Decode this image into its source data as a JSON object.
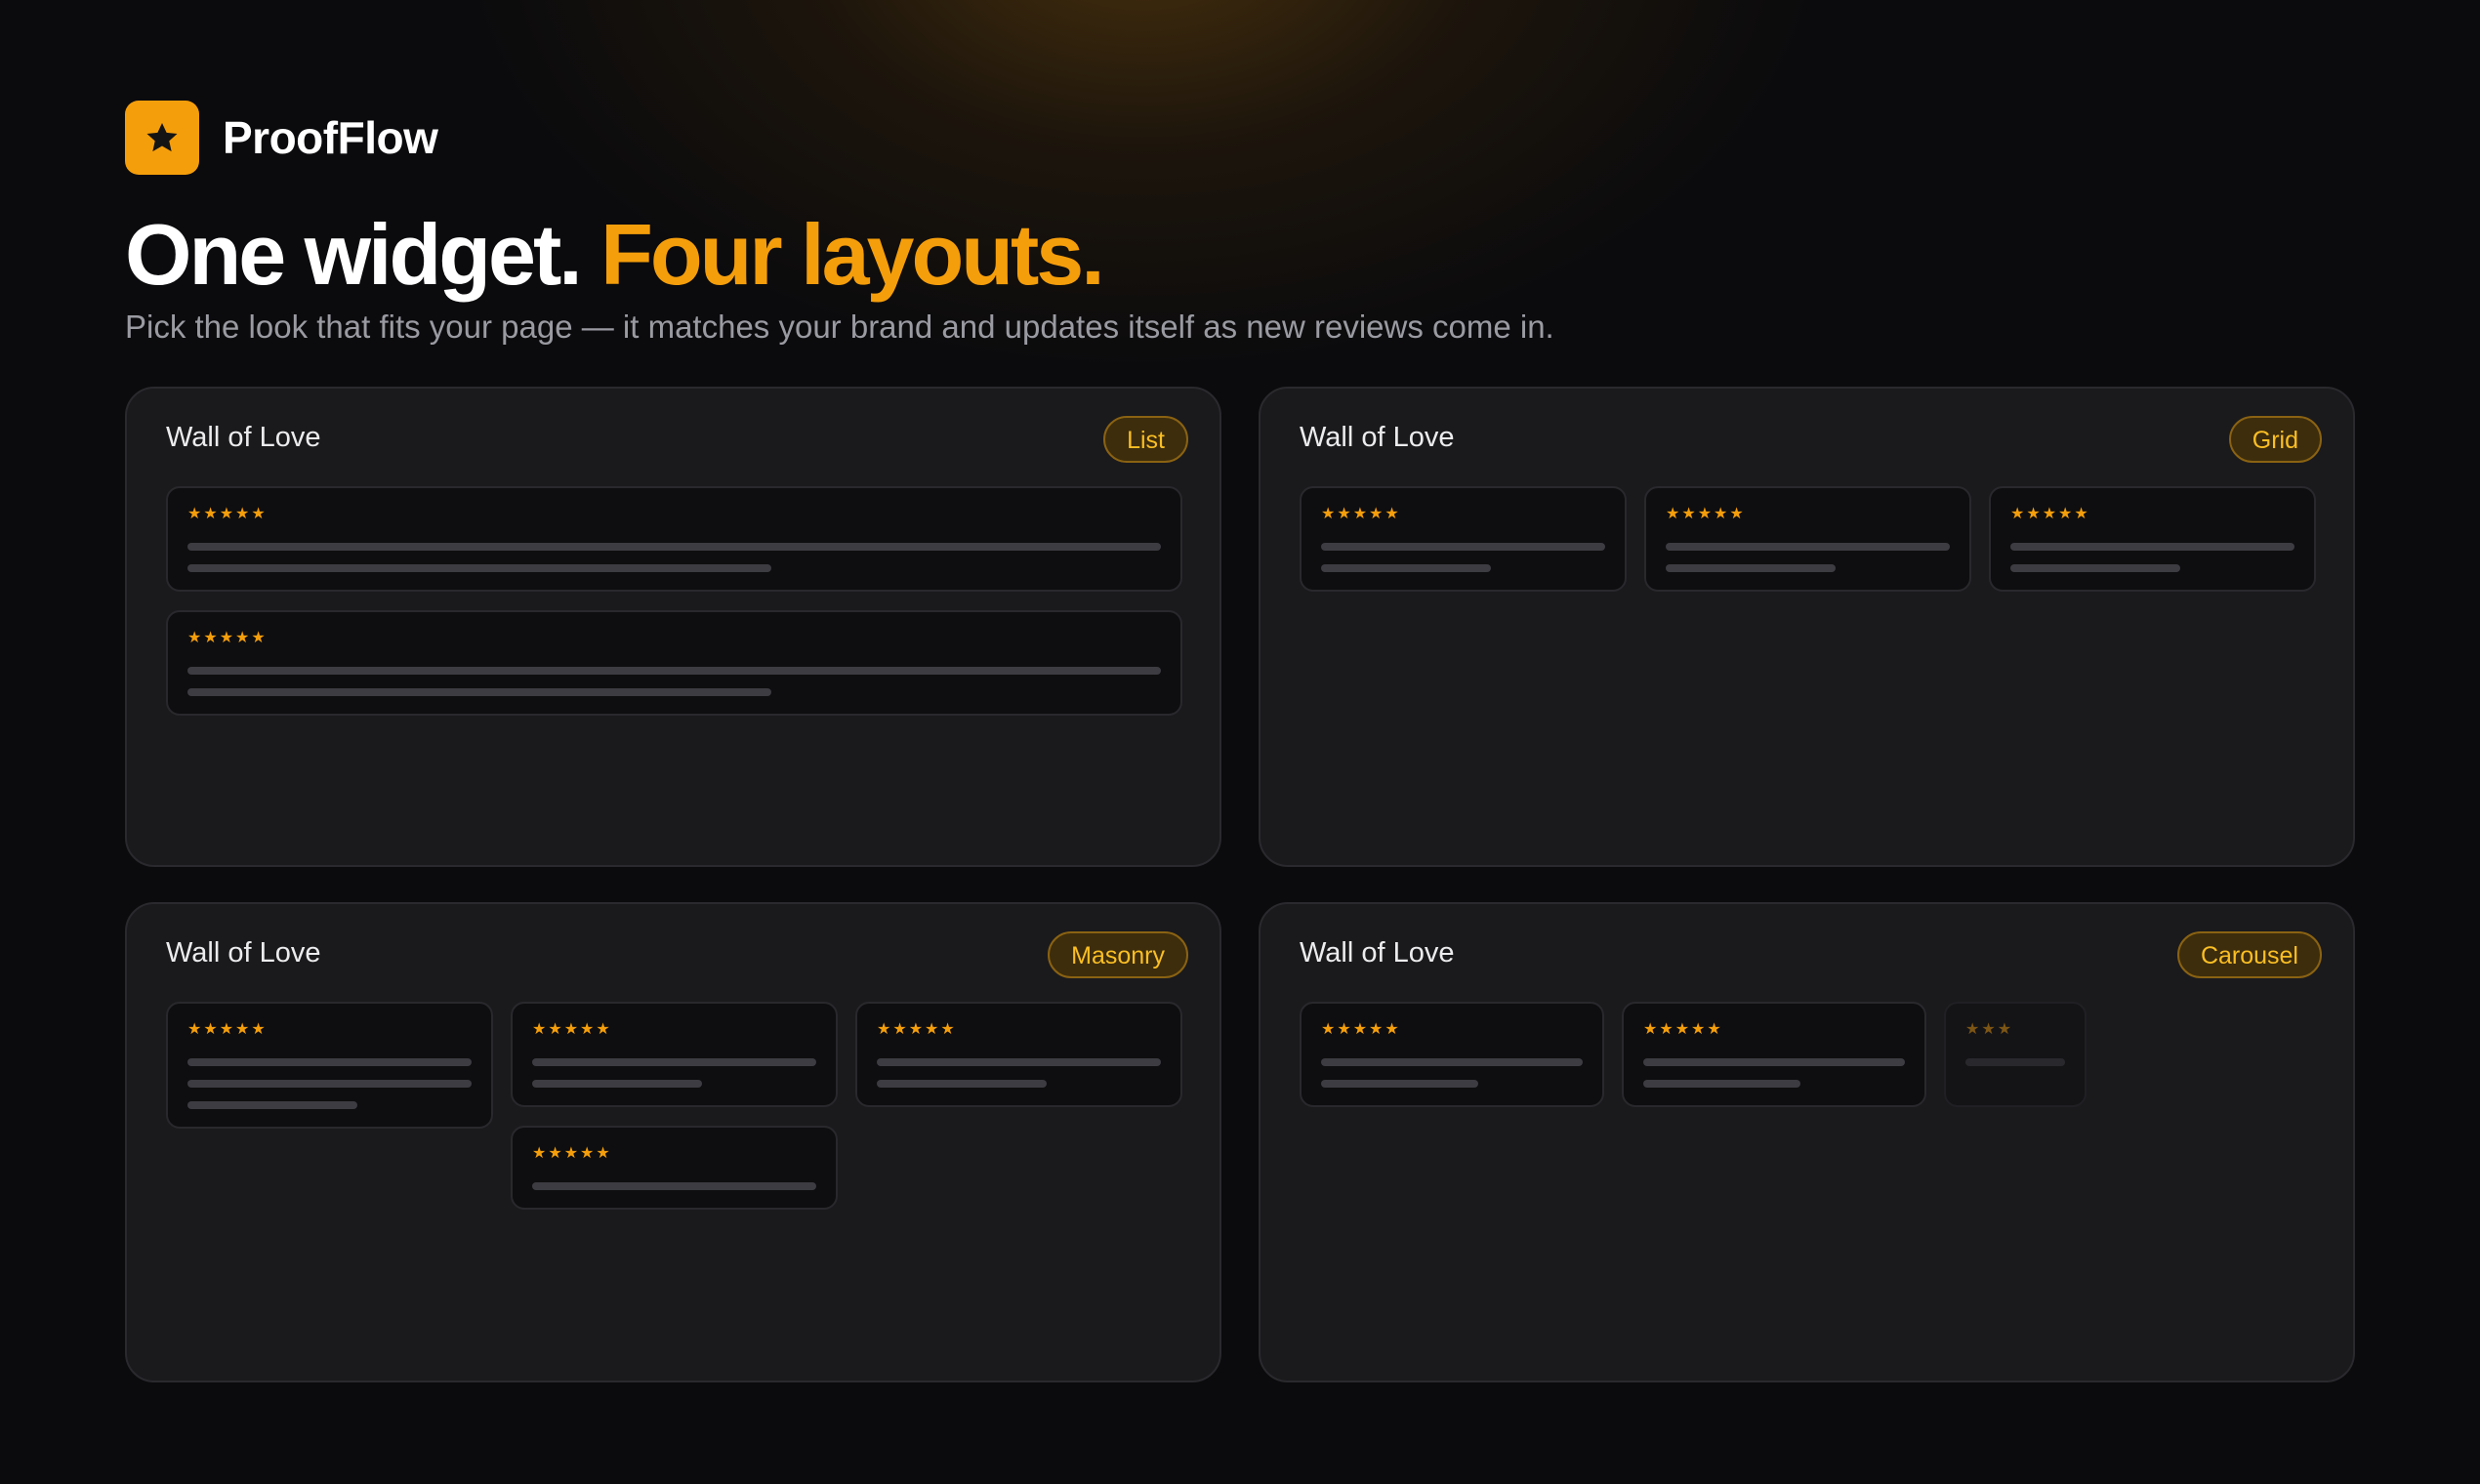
{
  "brand": {
    "name": "ProofFlow",
    "logo_icon": "star-icon",
    "accent_color": "#f59e0b"
  },
  "hero": {
    "headline_main": "One widget.",
    "headline_accent": "Four layouts.",
    "subtitle": "Pick the look that fits your page — it matches your brand and updates itself as new reviews come in."
  },
  "panels": [
    {
      "title": "Wall of Love",
      "layout_badge": "List"
    },
    {
      "title": "Wall of Love",
      "layout_badge": "Grid"
    },
    {
      "title": "Wall of Love",
      "layout_badge": "Masonry"
    },
    {
      "title": "Wall of Love",
      "layout_badge": "Carousel"
    }
  ],
  "review": {
    "stars": "★★★★★",
    "stars_partial": "★★★",
    "star_color": "#f59e0b"
  }
}
